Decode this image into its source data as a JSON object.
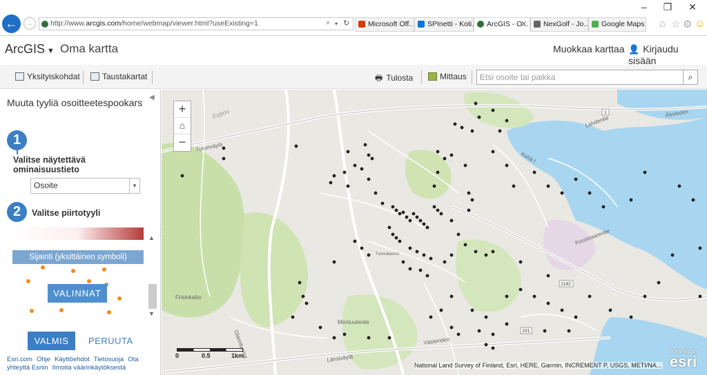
{
  "browser": {
    "url_prefix": "http://www.",
    "url_domain": "arcgis.com",
    "url_path": "/home/webmap/viewer.html?useExisting=1",
    "tabs": [
      {
        "label": "Microsoft Off...",
        "icon": "office-icon",
        "color": "#d83b01"
      },
      {
        "label": "SPInetti - Koti...",
        "icon": "sharepoint-icon",
        "color": "#0078d4"
      },
      {
        "label": "ArcGIS - O...",
        "icon": "arcgis-globe-icon",
        "color": "#2f6f3f",
        "active": true
      },
      {
        "label": "NexGolf - Jo...",
        "icon": "nexgolf-icon",
        "color": "#666666"
      },
      {
        "label": "Google Maps",
        "icon": "google-maps-icon",
        "color": "#4caf50"
      }
    ],
    "window_controls": {
      "minimize": "–",
      "restore": "❐",
      "close": "✕"
    }
  },
  "header": {
    "brand": "ArcGIS",
    "map_title": "Oma kartta",
    "edit_map": "Muokkaa karttaa",
    "sign_in": "Kirjaudu sisään"
  },
  "toolbar": {
    "details": "Yksityiskohdat",
    "basemaps": "Taustakartat",
    "print": "Tulosta",
    "measure": "Mittaus",
    "search_placeholder": "Etsi osoite tai paikka"
  },
  "panel": {
    "title": "Muuta tyyliä osoitteetespookars",
    "step1_number": "1",
    "step1_label": "Valitse näytettävä ominaisuustieto",
    "attribute_value": "Osoite",
    "step2_number": "2",
    "step2_label": "Valitse piirtotyyli",
    "style_option": "Sijainti (yksittäinen symboli)",
    "options_button": "VALINNAT",
    "done_button": "VALMIS",
    "cancel_button": "PERUUTA",
    "footer_links": [
      "Esri.com",
      "Ohje",
      "Käyttöehdot",
      "Tietosuoja",
      "Ota yhteyttä Esriin",
      "Ilmoita väärinkäytöksestä"
    ]
  },
  "map": {
    "scale_labels": [
      "0",
      "0.5",
      "1km"
    ],
    "attribution": "National Land Survey of Finland, Esri, HERE, Garmin, INCREMENT P, USGS, METI/NA...",
    "esri_badge": "esri",
    "esri_powered": "POWERED BY",
    "place_labels": [
      "Turunväylä",
      "Kehä I",
      "Espoo",
      "Kuusisaarentie",
      "Lahdentie",
      "Frisinkallio",
      "Olarinluoma",
      "Mentuulentie",
      "Länsiväylä",
      "Västeriden",
      "Åboleden",
      "Tunnukasivu"
    ],
    "road_numbers": [
      "1",
      "101",
      "1142"
    ],
    "colors": {
      "water": "#a8d6f0",
      "park": "#c8dfaa",
      "point": "#222222"
    }
  }
}
